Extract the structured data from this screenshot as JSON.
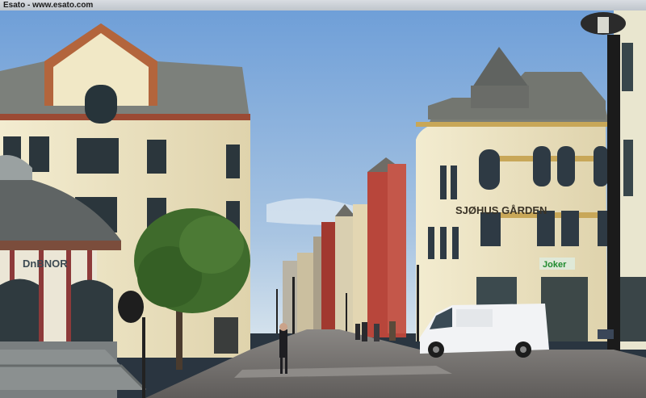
{
  "window": {
    "title": "Esato - www.esato.com"
  },
  "photo": {
    "signs": {
      "dnb_nor": "DnBNOR",
      "hotel": "SJØHUS GÅRDEN",
      "joker": "Joker"
    }
  },
  "colors": {
    "sky_top": "#6f9fd8",
    "sky_bottom": "#c9dbe9",
    "cream_facade": "#efe6c5",
    "roof": "#7b7f7a",
    "red_building": "#b8463b",
    "van": "#f2f3f5",
    "street": "#6d6a68"
  }
}
